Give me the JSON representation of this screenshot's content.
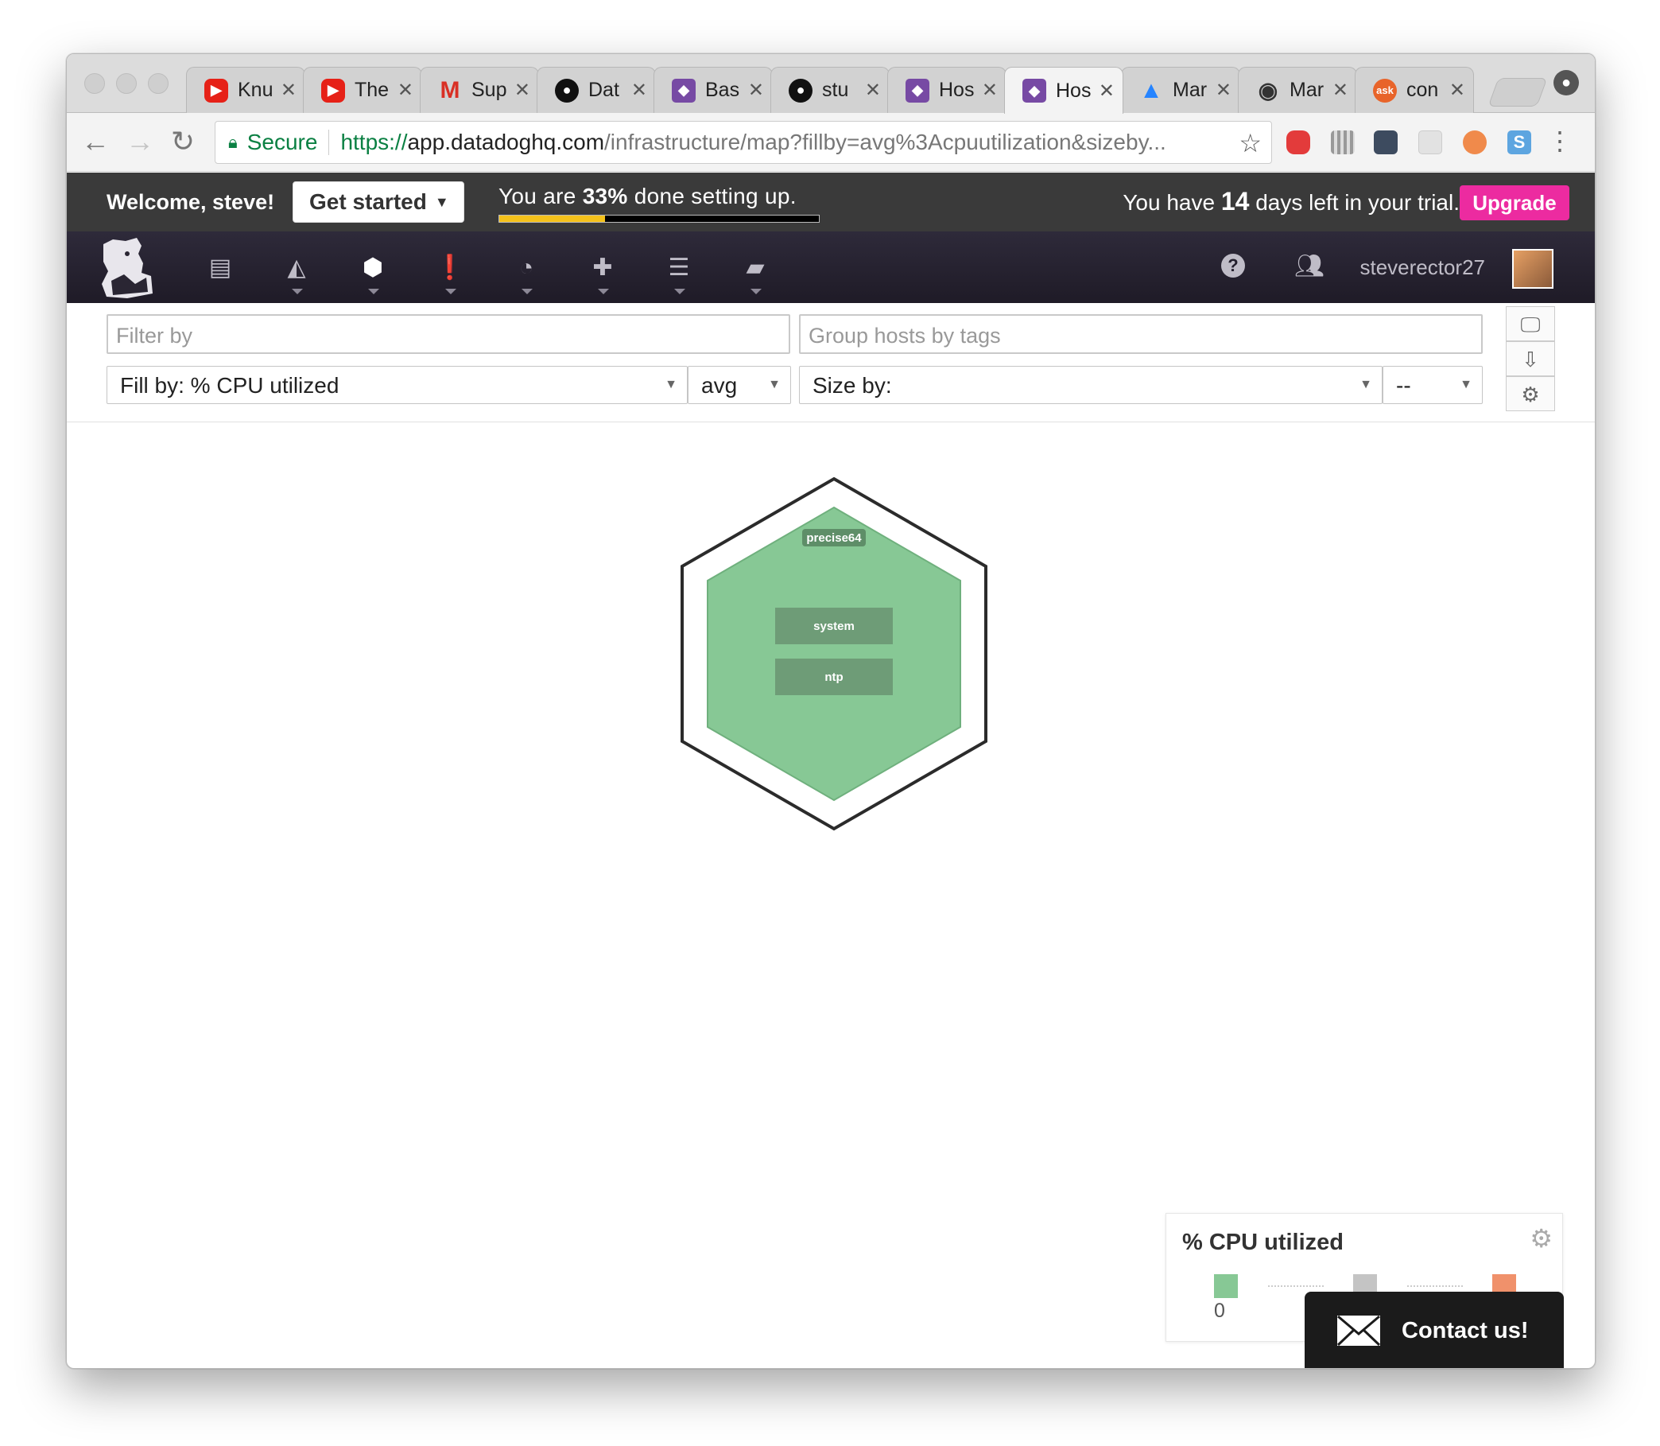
{
  "browser": {
    "tabs": [
      {
        "icon": "youtube-icon",
        "title": "Knu"
      },
      {
        "icon": "youtube-icon",
        "title": "The"
      },
      {
        "icon": "gmail-icon",
        "title": "Sup"
      },
      {
        "icon": "github-icon",
        "title": "Dat"
      },
      {
        "icon": "datadog-icon",
        "title": "Bas"
      },
      {
        "icon": "github-icon",
        "title": "stu"
      },
      {
        "icon": "datadog-icon",
        "title": "Hos"
      },
      {
        "icon": "datadog-icon",
        "title": "Hos",
        "active": true
      },
      {
        "icon": "atlassian-icon",
        "title": "Mar"
      },
      {
        "icon": "eye-icon",
        "title": "Mar"
      },
      {
        "icon": "ask-icon",
        "title": "con"
      }
    ],
    "url": {
      "secure_label": "Secure",
      "scheme": "https://",
      "host": "app.datadoghq.com",
      "path": "/infrastructure/map?fillby=avg%3Acpuutilization&sizeby..."
    }
  },
  "setup": {
    "welcome": "Welcome, steve!",
    "get_started": "Get started",
    "progress_prefix": "You are ",
    "progress_pct": "33%",
    "progress_suffix": " done setting up.",
    "progress_fraction": 0.33,
    "trial_prefix": "You have ",
    "trial_days": "14",
    "trial_suffix": " days left in your trial.",
    "upgrade": "Upgrade"
  },
  "nav": {
    "username": "steverector27"
  },
  "filters": {
    "filter_placeholder": "Filter by",
    "group_placeholder": "Group hosts by tags",
    "fill_by": "Fill by: % CPU utilized",
    "fill_agg": "avg",
    "size_by": "Size by:",
    "size_agg": "--"
  },
  "hostmap": {
    "host_name": "precise64",
    "apps": [
      "system",
      "ntp"
    ],
    "host_fill": "#87c895"
  },
  "legend": {
    "title": "% CPU utilized",
    "min_label": "0",
    "colors": [
      "#87c895",
      "#c4c4c4",
      "#f0916b"
    ]
  },
  "contact": {
    "label": "Contact us!"
  }
}
